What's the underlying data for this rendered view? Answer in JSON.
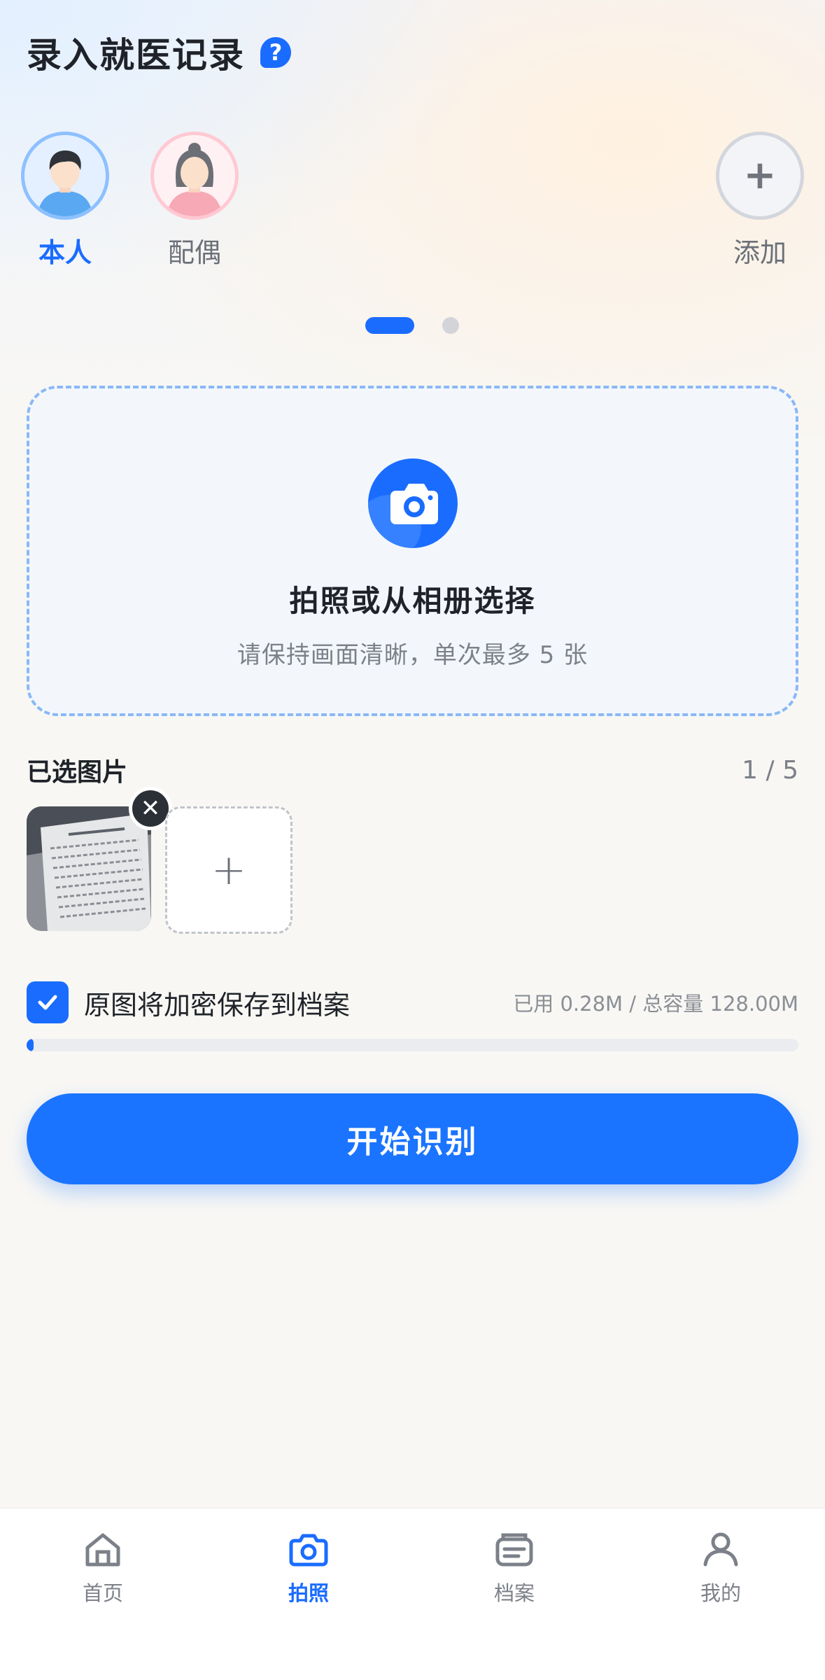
{
  "header": {
    "title": "录入就医记录",
    "help_icon": "?"
  },
  "members": [
    {
      "label": "本人",
      "icon": "male-avatar-icon",
      "active": true
    },
    {
      "label": "配偶",
      "icon": "female-avatar-icon",
      "active": false
    }
  ],
  "add_member": {
    "label": "添加",
    "icon": "+"
  },
  "pager": {
    "pages": 2,
    "current": 1
  },
  "upload": {
    "title": "拍照或从相册选择",
    "subtitle": "请保持画面清晰，单次最多 5 张",
    "icon": "camera-icon"
  },
  "selected": {
    "title": "已选图片",
    "count": "1 / 5",
    "remove_icon": "✕",
    "add_icon": "+"
  },
  "save": {
    "checked": true,
    "label": "原图将加密保存到档案",
    "storage": "已用 0.28M / 总容量 128.00M",
    "used_fraction": 0.0022
  },
  "action": {
    "start_label": "开始识别"
  },
  "tabs": [
    {
      "label": "首页",
      "icon": "home-icon",
      "active": false
    },
    {
      "label": "拍照",
      "icon": "camera-icon",
      "active": true
    },
    {
      "label": "档案",
      "icon": "archive-icon",
      "active": false
    },
    {
      "label": "我的",
      "icon": "user-icon",
      "active": false
    }
  ],
  "colors": {
    "accent": "#1a6cff",
    "background": "#f8f7f4"
  }
}
